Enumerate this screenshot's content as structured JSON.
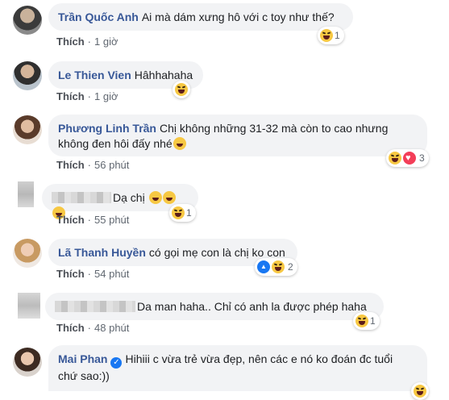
{
  "comments": [
    {
      "author": "Trần Quốc Anh",
      "text": "Ai mà dám xưng hô với c toy như thế?",
      "action": "Thích",
      "sep": "·",
      "time": "1 giờ",
      "reaction_count": "1",
      "reactions": [
        "haha"
      ]
    },
    {
      "author": "Le Thien Vien",
      "text": "Hâhhahaha",
      "action": "Thích",
      "sep": "·",
      "time": "1 giờ",
      "reaction_count": "",
      "reactions": [
        "haha"
      ]
    },
    {
      "author": "Phương Linh Trần",
      "text": "Chị không những 31-32 mà còn to cao nhưng",
      "text2": "không đen hôi đấy nhé",
      "action": "Thích",
      "sep": "·",
      "time": "56 phút",
      "reaction_count": "3",
      "reactions": [
        "haha",
        "love"
      ]
    },
    {
      "author": "",
      "text": "Dạ chị",
      "action": "Thích",
      "sep": "·",
      "time": "55 phút",
      "reaction_count": "1",
      "reactions": [
        "haha"
      ]
    },
    {
      "author": "Lã Thanh Huyền",
      "text": "có gọi mẹ con là chị ko con",
      "action": "Thích",
      "sep": "·",
      "time": "54 phút",
      "reaction_count": "2",
      "reactions": [
        "like",
        "haha"
      ]
    },
    {
      "author": "",
      "text": "Da man haha.. Chỉ có anh la được phép haha",
      "action": "Thích",
      "sep": "·",
      "time": "48 phút",
      "reaction_count": "1",
      "reactions": [
        "haha"
      ]
    },
    {
      "author": "Mai Phan",
      "text": "Hihiii c vừa trẻ vừa đẹp, nên các e nó ko đoán đc tuổi",
      "text2": "chứ sao:))",
      "verified_icon": "verified-badge-icon",
      "reactions": [
        "haha"
      ]
    }
  ],
  "colors": {
    "author": "#385898",
    "bubble": "#f2f3f5",
    "meta": "#606770"
  }
}
